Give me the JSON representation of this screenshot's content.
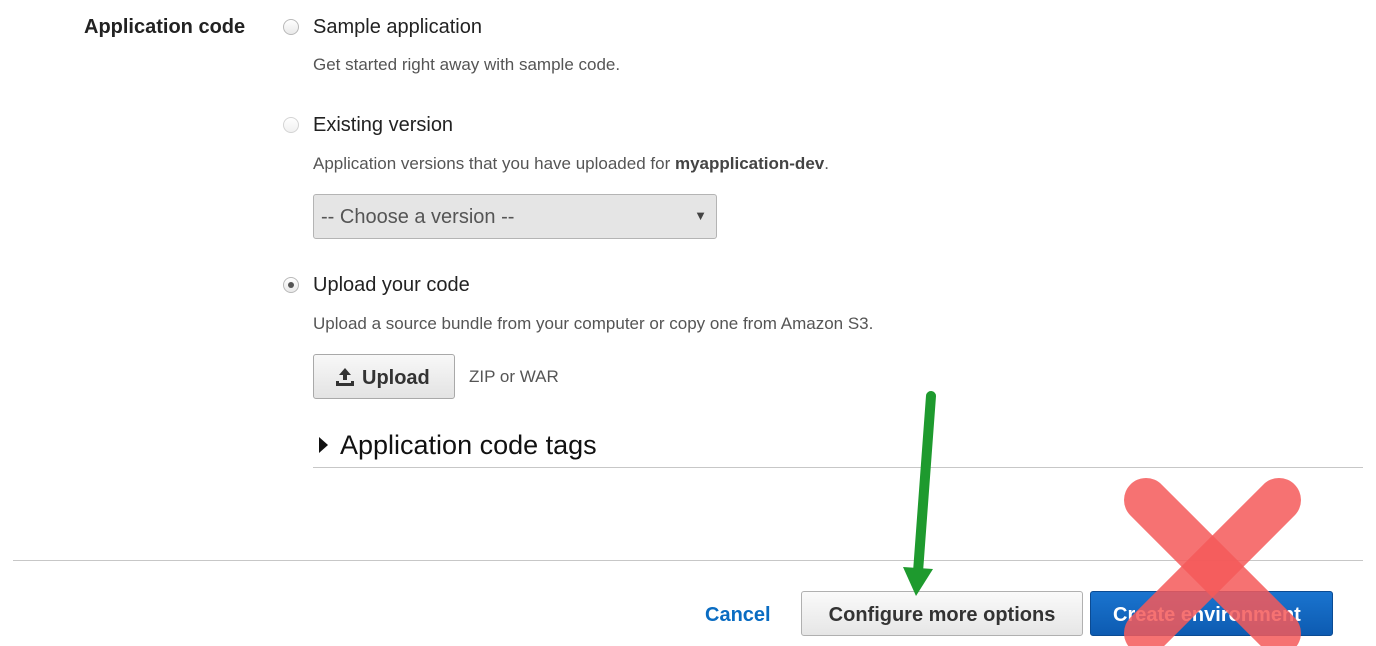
{
  "application_code": {
    "section_label": "Application code",
    "options": [
      {
        "label": "Sample application",
        "description": "Get started right away with sample code.",
        "selected": false
      },
      {
        "label": "Existing version",
        "description_prefix": "Application versions that you have uploaded for ",
        "description_bold": "myapplication-dev",
        "description_suffix": ".",
        "selected": false,
        "disabled": true,
        "version_select": {
          "selected_value": "-- Choose a version --"
        }
      },
      {
        "label": "Upload your code",
        "description": "Upload a source bundle from your computer or copy one from Amazon S3.",
        "selected": true,
        "upload_button_label": "Upload",
        "upload_hint": "ZIP or WAR"
      }
    ],
    "tags_toggle_label": "Application code tags"
  },
  "footer": {
    "cancel_label": "Cancel",
    "configure_label": "Configure more options",
    "create_label": "Create environment"
  },
  "annotations": {
    "arrow_color": "#1e9a2e",
    "cross_color": "#f55a5a"
  },
  "icons": {
    "upload": "upload-icon",
    "caret": "caret-down-icon",
    "expand": "triangle-right-icon"
  }
}
